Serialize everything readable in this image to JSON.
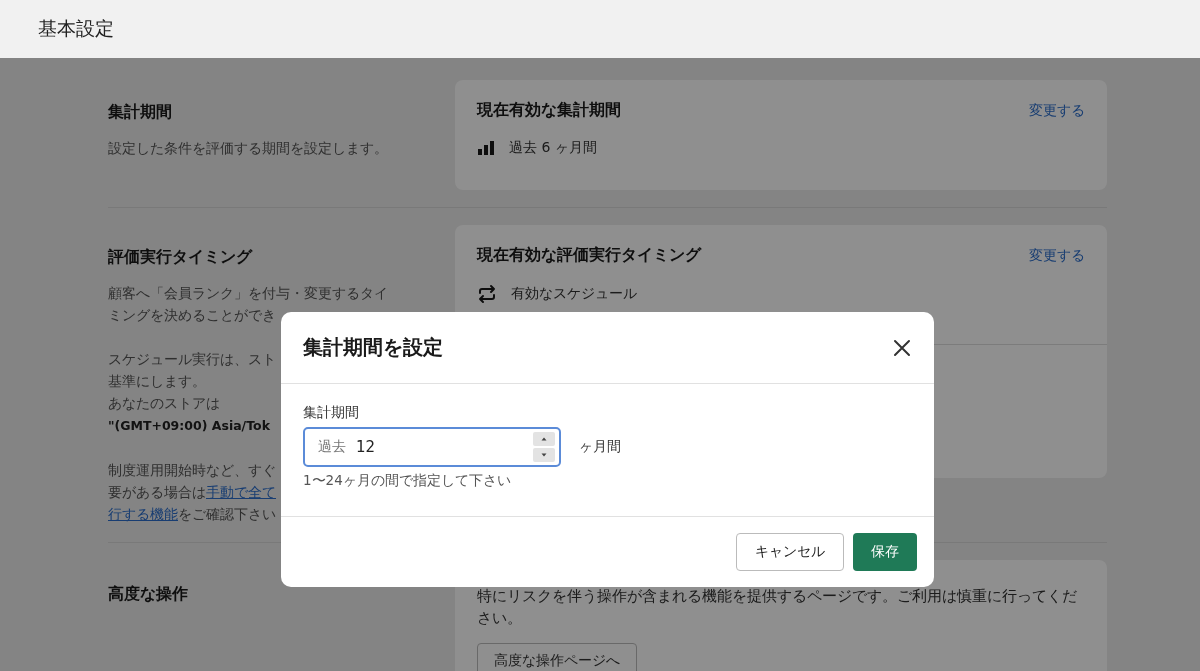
{
  "header": {
    "title": "基本設定"
  },
  "sections": [
    {
      "title": "集計期間",
      "lines": [
        [
          {
            "text": "設定した条件を評価する期間を設定します。",
            "kind": "text"
          }
        ]
      ],
      "card": {
        "title": "現在有効な集計期間",
        "action": "変更する",
        "value": "過去 6 ヶ月間"
      }
    },
    {
      "title": "評価実行タイミング",
      "lines": [
        [
          {
            "text": "顧客へ「会員ランク」を付与・変更するタイ",
            "kind": "text"
          }
        ],
        [
          {
            "text": "ミングを決めることができ",
            "kind": "text"
          }
        ],
        [
          {
            "kind": "gap"
          }
        ],
        [
          {
            "text": "スケジュール実行は、スト",
            "kind": "text"
          }
        ],
        [
          {
            "text": "基準にします。",
            "kind": "text"
          }
        ],
        [
          {
            "text": "あなたのストアは",
            "kind": "text"
          }
        ],
        [
          {
            "text": "\"(GMT+09:00) Asia/Tok",
            "kind": "bold"
          }
        ],
        [
          {
            "kind": "gap"
          }
        ],
        [
          {
            "text": "制度運用開始時など、すぐ",
            "kind": "text"
          }
        ],
        [
          {
            "text": "要がある場合は",
            "kind": "text"
          },
          {
            "text": "手動で全て",
            "kind": "link"
          }
        ],
        [
          {
            "text": "行する機能",
            "kind": "link"
          },
          {
            "text": "をご確認下さい",
            "kind": "text"
          }
        ]
      ],
      "card": {
        "title": "現在有効な評価実行タイミング",
        "action": "変更する",
        "value": "有効なスケジュール"
      }
    },
    {
      "title": "高度な操作",
      "card": {
        "description": "特にリスクを伴う操作が含まれる機能を提供するページです。ご利用は慎重に行ってください。",
        "button": "高度な操作ページへ"
      }
    }
  ],
  "dialog": {
    "title": "集計期間を設定",
    "field_label": "集計期間",
    "prefix": "過去",
    "value": "12",
    "suffix": "ヶ月間",
    "help": "1〜24ヶ月の間で指定して下さい",
    "buttons": [
      {
        "label": "キャンセル",
        "kind": "secondary"
      },
      {
        "label": "保存",
        "kind": "primary"
      }
    ]
  }
}
